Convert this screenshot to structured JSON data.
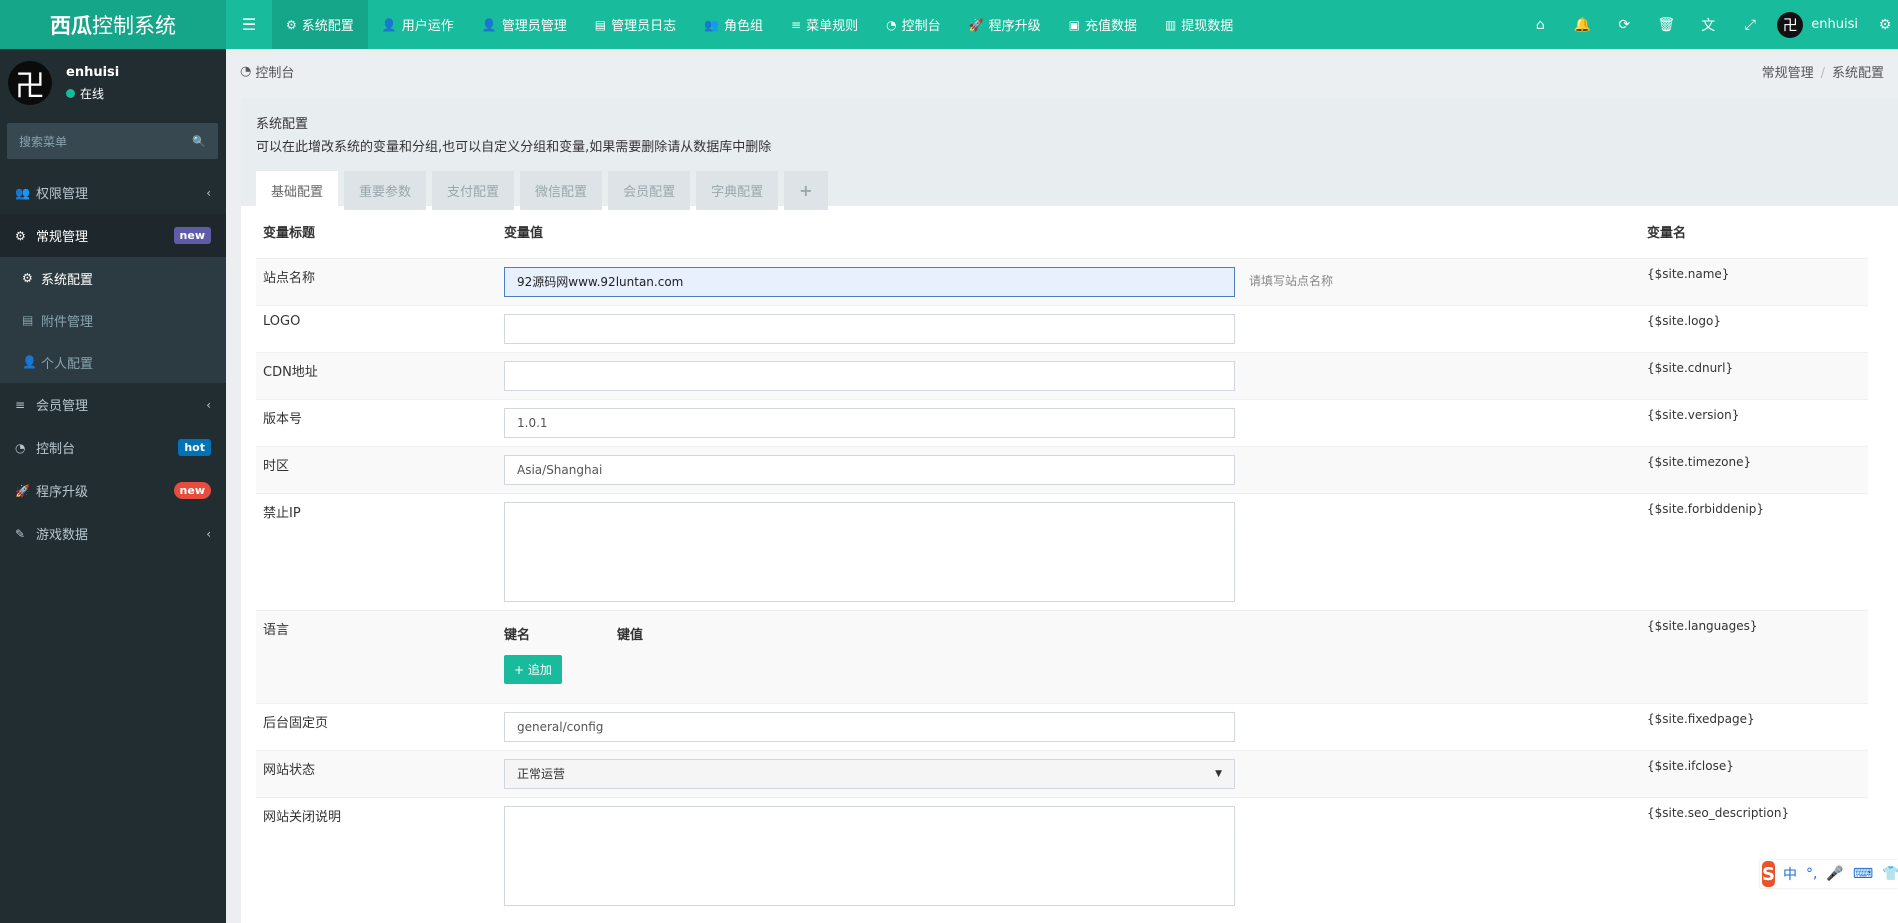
{
  "header": {
    "logo_bold": "西瓜",
    "logo_rest": "控制系统",
    "toggle_icon": "☰",
    "nav": [
      {
        "icon": "⚙",
        "label": "系统配置",
        "active": true
      },
      {
        "icon": "👤",
        "label": "用户运作"
      },
      {
        "icon": "👤",
        "label": "管理员管理"
      },
      {
        "icon": "▤",
        "label": "管理员日志"
      },
      {
        "icon": "👥",
        "label": "角色组"
      },
      {
        "icon": "≡",
        "label": "菜单规则"
      },
      {
        "icon": "◔",
        "label": "控制台"
      },
      {
        "icon": "🚀",
        "label": "程序升级"
      },
      {
        "icon": "▣",
        "label": "充值数据"
      },
      {
        "icon": "▥",
        "label": "提现数据"
      }
    ],
    "right_icons": [
      "⌂",
      "🔔",
      "⟳",
      "🗑",
      "文",
      "⤢"
    ],
    "user_avatar": "卍",
    "user_name": "enhuisi",
    "settings_icon": "⚙"
  },
  "sidebar": {
    "avatar": "卍",
    "username": "enhuisi",
    "status": "在线",
    "search_placeholder": "搜索菜单",
    "search_icon": "🔍",
    "items": [
      {
        "icon": "👥",
        "label": "权限管理",
        "arrow": "‹"
      },
      {
        "icon": "⚙",
        "label": "常规管理",
        "badge": "new"
      },
      {
        "icon": "≡",
        "label": "会员管理",
        "arrow": "‹"
      },
      {
        "icon": "◔",
        "label": "控制台",
        "badge": "hot"
      },
      {
        "icon": "🚀",
        "label": "程序升级",
        "badge": "new"
      },
      {
        "icon": "✎",
        "label": "游戏数据",
        "arrow": "‹"
      }
    ],
    "sub_items": [
      {
        "icon": "⚙",
        "label": "系统配置"
      },
      {
        "icon": "▤",
        "label": "附件管理"
      },
      {
        "icon": "👤",
        "label": "个人配置"
      }
    ]
  },
  "content_header": {
    "icon": "◔",
    "title": "控制台",
    "breadcrumb": [
      "常规管理",
      "系统配置"
    ],
    "breadcrumb_sep": "/"
  },
  "panel": {
    "title": "系统配置",
    "desc": "可以在此增改系统的变量和分组,也可以自定义分组和变量,如果需要删除请从数据库中删除",
    "tabs": [
      "基础配置",
      "重要参数",
      "支付配置",
      "微信配置",
      "会员配置",
      "字典配置",
      "+"
    ],
    "columns": [
      "变量标题",
      "变量值",
      "",
      "变量名"
    ],
    "rows": [
      {
        "title": "站点名称",
        "value": "92源码网www.92luntan.com",
        "hint": "请填写站点名称",
        "var": "{$site.name}"
      },
      {
        "title": "LOGO",
        "value": "",
        "var": "{$site.logo}"
      },
      {
        "title": "CDN地址",
        "value": "",
        "var": "{$site.cdnurl}"
      },
      {
        "title": "版本号",
        "value": "1.0.1",
        "var": "{$site.version}"
      },
      {
        "title": "时区",
        "value": "Asia/Shanghai",
        "var": "{$site.timezone}"
      },
      {
        "title": "禁止IP",
        "value": "",
        "var": "{$site.forbiddenip}"
      },
      {
        "title": "语言",
        "key_header": "键名",
        "val_header": "键值",
        "add_label": "+ 追加",
        "var": "{$site.languages}"
      },
      {
        "title": "后台固定页",
        "value": "general/config",
        "var": "{$site.fixedpage}"
      },
      {
        "title": "网站状态",
        "value": "正常运营",
        "var": "{$site.ifclose}"
      },
      {
        "title": "网站关闭说明",
        "value": "",
        "var": "{$site.seo_description}"
      }
    ]
  },
  "ime": {
    "logo": "S",
    "glyphs": [
      "中",
      "°,",
      "🎤",
      "⌨",
      "👕"
    ]
  }
}
